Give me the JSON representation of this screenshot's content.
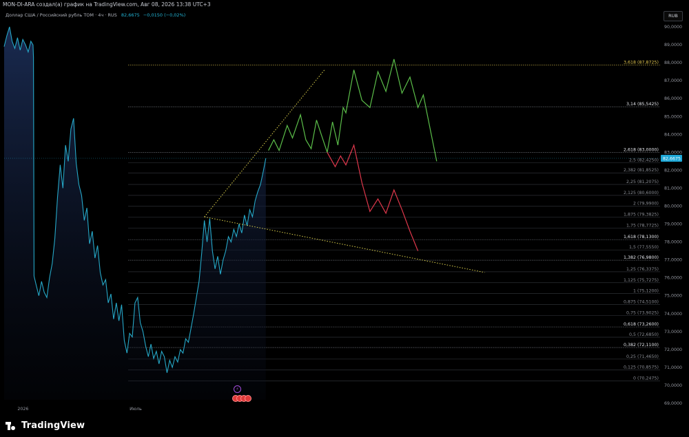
{
  "caption": "MON-DI-ARA создал(а) график на TradingView.com, Авг 08, 2026 13:38 UTC+3",
  "symbol": {
    "description": "Доллар США / Российский рубль TOM · 4ч · RUS",
    "price": "82,6675",
    "change": "−0,0150 (−0,02%)"
  },
  "currency_button": "RUB",
  "brand": "TradingView",
  "icons": {
    "events": "lightning-icon",
    "earnings": "flag-usa-icon"
  },
  "colors": {
    "price_line": "#26a9c9",
    "area_fill": "#1b2d55",
    "fib_line": "#3a3d44",
    "fib_highlight": "#e0c54d",
    "green_path": "#5cbf4a",
    "red_path": "#e0384c",
    "trend_line": "#e0d44d",
    "price_badge": "#1ea7d6"
  },
  "chart_data": {
    "type": "line",
    "y_axis": {
      "range": [
        69,
        90.5
      ],
      "ticks": [
        69,
        70,
        71,
        72,
        73,
        74,
        75,
        76,
        77,
        78,
        79,
        80,
        81,
        82,
        83,
        84,
        85,
        86,
        87,
        88,
        89,
        90
      ],
      "tick_labels": [
        "69,0000",
        "70,0000",
        "71,0000",
        "72,0000",
        "73,0000",
        "74,0000",
        "75,0000",
        "76,0000",
        "77,0000",
        "78,0000",
        "79,0000",
        "80,0000",
        "81,0000",
        "82,0000",
        "83,0000",
        "84,0000",
        "85,0000",
        "86,0000",
        "87,0000",
        "88,0000",
        "89,0000",
        "90,0000"
      ]
    },
    "x_axis": {
      "ticks": [
        {
          "label": "2026",
          "t": 5
        },
        {
          "label": "Июль",
          "t": 47
        }
      ],
      "range": [
        0,
        160
      ]
    },
    "last_price": 82.6675,
    "last_price_label": "82,6675",
    "fib_levels": [
      {
        "label": "3,618 (87,8725)",
        "value": 87.8725,
        "highlight": true
      },
      {
        "label": "3,14 (85,5425)",
        "value": 85.5425,
        "bold": true
      },
      {
        "label": "2,618 (83,0000)",
        "value": 83.0,
        "bold": true
      },
      {
        "label": "2,5 (82,4250)",
        "value": 82.425
      },
      {
        "label": "2,382 (81,8525)",
        "value": 81.8525
      },
      {
        "label": "2,25 (81,2075)",
        "value": 81.2075
      },
      {
        "label": "2,125 (80,6000)",
        "value": 80.6
      },
      {
        "label": "2 (79,9900)",
        "value": 79.99
      },
      {
        "label": "1,875 (79,3825)",
        "value": 79.3825
      },
      {
        "label": "1,75 (78,7725)",
        "value": 78.7725
      },
      {
        "label": "1,618 (78,1300)",
        "value": 78.13,
        "bold": true
      },
      {
        "label": "1,5 (77,5550)",
        "value": 77.555
      },
      {
        "label": "1,382 (76,9800)",
        "value": 76.98,
        "bold": true
      },
      {
        "label": "1,25 (76,3375)",
        "value": 76.3375
      },
      {
        "label": "1,125 (75,7275)",
        "value": 75.7275
      },
      {
        "label": "1 (75,1200)",
        "value": 75.12
      },
      {
        "label": "0,875 (74,5100)",
        "value": 74.51
      },
      {
        "label": "0,75 (73,9025)",
        "value": 73.9025
      },
      {
        "label": "0,618 (73,2600)",
        "value": 73.26,
        "bold": true
      },
      {
        "label": "0,5 (72,6850)",
        "value": 72.685
      },
      {
        "label": "0,382 (72,1100)",
        "value": 72.11,
        "bold": true
      },
      {
        "label": "0,25 (71,4650)",
        "value": 71.465
      },
      {
        "label": "0,125 (70,8575)",
        "value": 70.8575
      },
      {
        "label": "0 (70,2475)",
        "value": 70.2475
      }
    ],
    "series": [
      {
        "values": [
          [
            0,
            88.9
          ],
          [
            1,
            89.5
          ],
          [
            2,
            90.0
          ],
          [
            3,
            89.2
          ],
          [
            4,
            88.8
          ],
          [
            5,
            89.4
          ],
          [
            6,
            88.7
          ],
          [
            7,
            89.3
          ],
          [
            8,
            89.0
          ],
          [
            9,
            88.6
          ],
          [
            10,
            89.2
          ],
          [
            10.8,
            89.0
          ],
          [
            11,
            88.3
          ],
          [
            11.2,
            76.1
          ],
          [
            12,
            75.6
          ],
          [
            13,
            75.0
          ],
          [
            14,
            75.8
          ],
          [
            15,
            75.2
          ],
          [
            16,
            74.9
          ],
          [
            17,
            76.0
          ],
          [
            18,
            76.8
          ],
          [
            19,
            78.2
          ],
          [
            20,
            80.5
          ],
          [
            21,
            82.3
          ],
          [
            22,
            81.0
          ],
          [
            23,
            83.4
          ],
          [
            24,
            82.5
          ],
          [
            25,
            84.3
          ],
          [
            26,
            84.9
          ],
          [
            27,
            82.4
          ],
          [
            28,
            81.2
          ],
          [
            29,
            80.6
          ],
          [
            30,
            79.2
          ],
          [
            31,
            79.9
          ],
          [
            32,
            77.9
          ],
          [
            33,
            78.6
          ],
          [
            34,
            77.1
          ],
          [
            35,
            77.8
          ],
          [
            36,
            76.3
          ],
          [
            37,
            75.6
          ],
          [
            38,
            75.9
          ],
          [
            39,
            74.6
          ],
          [
            40,
            75.1
          ],
          [
            41,
            73.7
          ],
          [
            42,
            74.6
          ],
          [
            43,
            73.6
          ],
          [
            44,
            74.5
          ],
          [
            45,
            72.5
          ],
          [
            46,
            71.8
          ],
          [
            47,
            72.9
          ],
          [
            48,
            72.7
          ],
          [
            49,
            74.6
          ],
          [
            50,
            74.9
          ],
          [
            51,
            73.5
          ],
          [
            52,
            73.0
          ],
          [
            53,
            72.2
          ],
          [
            54,
            71.6
          ],
          [
            55,
            72.3
          ],
          [
            56,
            71.5
          ],
          [
            57,
            71.9
          ],
          [
            58,
            71.2
          ],
          [
            59,
            71.9
          ],
          [
            60,
            71.6
          ],
          [
            61,
            70.7
          ],
          [
            62,
            71.4
          ],
          [
            63,
            71.0
          ],
          [
            64,
            71.6
          ],
          [
            65,
            71.3
          ],
          [
            66,
            72.0
          ],
          [
            67,
            71.8
          ],
          [
            68,
            72.6
          ],
          [
            69,
            72.4
          ],
          [
            70,
            73.2
          ],
          [
            71,
            74.0
          ],
          [
            72,
            74.9
          ],
          [
            73,
            75.8
          ],
          [
            74,
            77.4
          ],
          [
            75,
            79.2
          ],
          [
            76,
            78.0
          ],
          [
            77,
            79.3
          ],
          [
            78,
            77.5
          ],
          [
            79,
            76.5
          ],
          [
            80,
            77.2
          ],
          [
            81,
            76.2
          ],
          [
            82,
            77.0
          ],
          [
            83,
            77.5
          ],
          [
            84,
            78.3
          ],
          [
            85,
            78.0
          ],
          [
            86,
            78.7
          ],
          [
            87,
            78.3
          ],
          [
            88,
            79.0
          ],
          [
            89,
            78.5
          ],
          [
            90,
            79.5
          ],
          [
            91,
            78.9
          ],
          [
            92,
            79.8
          ],
          [
            93,
            79.4
          ],
          [
            94,
            80.3
          ],
          [
            95,
            80.8
          ],
          [
            96,
            81.2
          ],
          [
            97,
            81.9
          ],
          [
            98,
            82.6675
          ]
        ]
      }
    ],
    "scenarios": [
      {
        "color": "green",
        "values": [
          [
            99,
            83.1
          ],
          [
            101,
            83.7
          ],
          [
            103,
            83.1
          ],
          [
            106,
            84.5
          ],
          [
            108,
            83.8
          ],
          [
            111,
            85.1
          ],
          [
            113,
            83.7
          ],
          [
            115,
            83.2
          ],
          [
            117,
            84.8
          ],
          [
            119,
            83.9
          ],
          [
            121,
            83.0
          ],
          [
            123,
            84.7
          ],
          [
            125,
            83.4
          ],
          [
            127,
            85.5
          ],
          [
            128,
            85.2
          ],
          [
            131,
            87.6
          ],
          [
            134,
            85.9
          ],
          [
            137,
            85.5
          ],
          [
            140,
            87.5
          ],
          [
            143,
            86.4
          ],
          [
            146,
            88.2
          ],
          [
            149,
            86.3
          ],
          [
            152,
            87.2
          ],
          [
            155,
            85.5
          ],
          [
            157,
            86.2
          ],
          [
            162,
            82.5
          ]
        ]
      },
      {
        "color": "red",
        "values": [
          [
            121,
            83.0
          ],
          [
            124,
            82.2
          ],
          [
            126,
            82.8
          ],
          [
            128,
            82.3
          ],
          [
            131,
            83.4
          ],
          [
            134,
            81.3
          ],
          [
            137,
            79.7
          ],
          [
            140,
            80.4
          ],
          [
            143,
            79.6
          ],
          [
            146,
            80.9
          ],
          [
            149,
            79.8
          ],
          [
            152,
            78.6
          ],
          [
            155,
            77.5
          ]
        ]
      }
    ],
    "trend_lines": [
      {
        "from": [
          75,
          79.4
        ],
        "to": [
          120,
          87.6
        ]
      },
      {
        "from": [
          75,
          79.4
        ],
        "to": [
          180,
          76.3
        ]
      }
    ]
  }
}
